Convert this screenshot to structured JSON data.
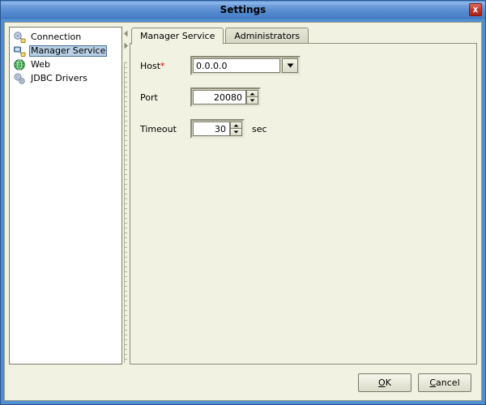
{
  "window": {
    "title": "Settings",
    "close_icon": "close-icon",
    "accent_titlebar": "#5d91d4",
    "background": "#f2f2e2"
  },
  "sidebar": {
    "items": [
      {
        "label": "Connection",
        "icon": "connection-icon",
        "selected": false
      },
      {
        "label": "Manager Service",
        "icon": "manager-service-icon",
        "selected": true
      },
      {
        "label": "Web",
        "icon": "web-globe-icon",
        "selected": false
      },
      {
        "label": "JDBC Drivers",
        "icon": "jdbc-drivers-icon",
        "selected": false
      }
    ],
    "selected_color": "#b8cfe5"
  },
  "divider": {
    "collapse_left_icon": "triangle-left-icon",
    "collapse_right_icon": "triangle-right-icon"
  },
  "tabs": [
    {
      "label": "Manager Service",
      "active": true
    },
    {
      "label": "Administrators",
      "active": false
    }
  ],
  "form": {
    "host": {
      "label": "Host",
      "required_marker": "*",
      "value": "0.0.0.0",
      "dropdown_icon": "chevron-down-icon"
    },
    "port": {
      "label": "Port",
      "value": "20080",
      "up_icon": "spinner-up-icon",
      "down_icon": "spinner-down-icon"
    },
    "timeout": {
      "label": "Timeout",
      "value": "30",
      "suffix": "sec",
      "up_icon": "spinner-up-icon",
      "down_icon": "spinner-down-icon"
    }
  },
  "buttons": {
    "ok": {
      "mnemonic": "O",
      "rest": "K"
    },
    "cancel": {
      "mnemonic": "C",
      "rest": "ancel"
    }
  }
}
